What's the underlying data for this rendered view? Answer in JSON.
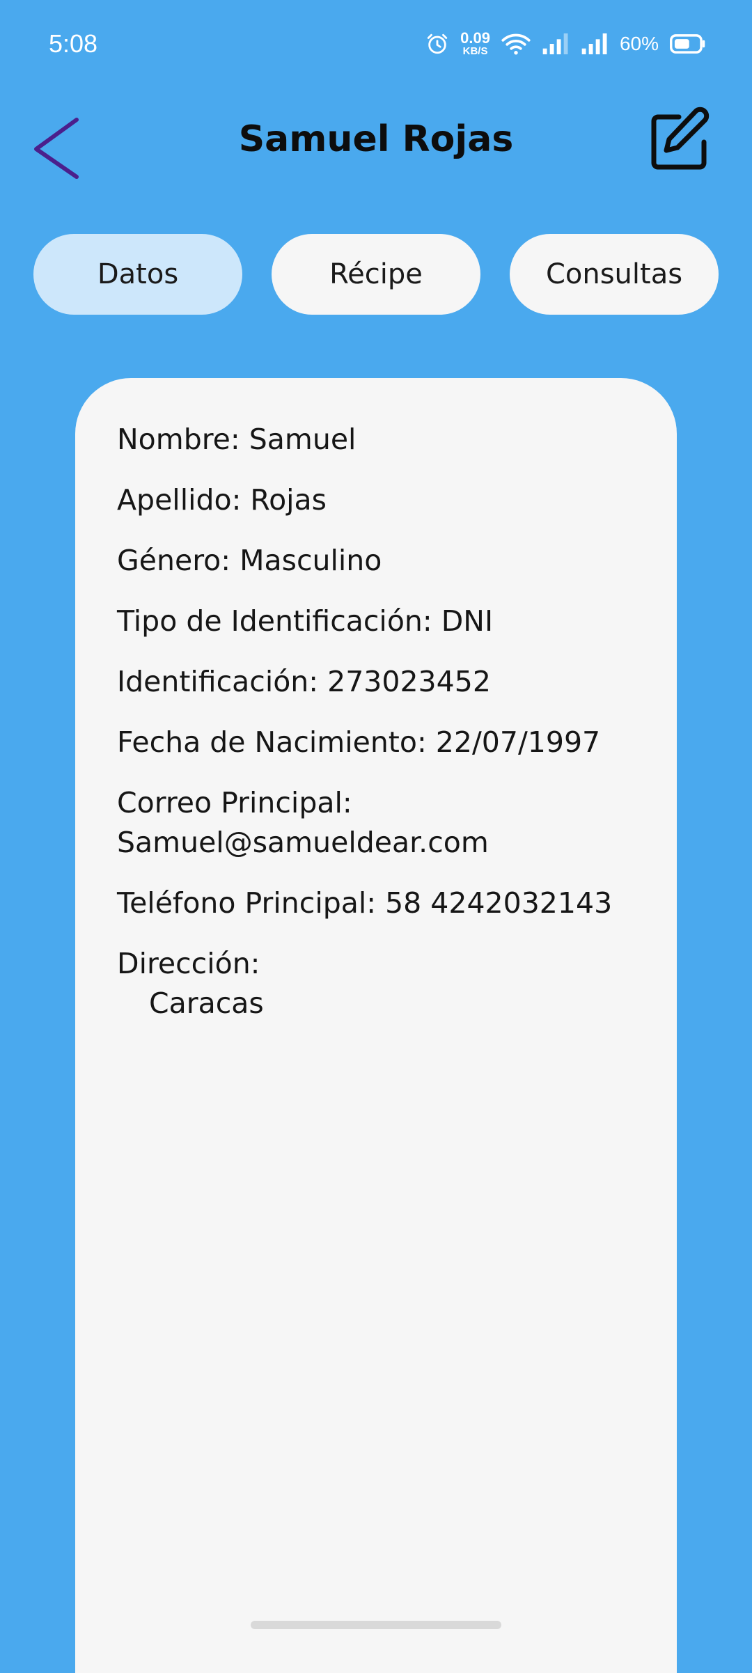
{
  "status_bar": {
    "time": "5:08",
    "net_speed_value": "0.09",
    "net_speed_unit": "KB/S",
    "battery": "60%",
    "icons": [
      "alarm-icon",
      "wifi-icon",
      "signal-icon",
      "signal-icon",
      "battery-icon"
    ]
  },
  "header": {
    "title": "Samuel Rojas",
    "back_icon": "chevron-left-icon",
    "edit_icon": "edit-icon"
  },
  "tabs": [
    {
      "label": "Datos",
      "active": true
    },
    {
      "label": "Récipe",
      "active": false
    },
    {
      "label": "Consultas",
      "active": false
    }
  ],
  "patient": {
    "nombre": "Nombre: Samuel",
    "apellido": "Apellido: Rojas",
    "genero": "Género: Masculino",
    "tipo_identificacion": "Tipo de Identificación: DNI",
    "identificacion": "Identificación: 273023452",
    "fecha_nacimiento": "Fecha de Nacimiento: 22/07/1997",
    "correo_label": "Correo Principal:",
    "correo_value": "Samuel@samueldear.com",
    "telefono": "Teléfono Principal: 58 4242032143",
    "direccion_label": "Dirección:",
    "direccion_value": "Caracas"
  },
  "colors": {
    "background": "#4aa9ee",
    "card": "#f6f6f6",
    "tab_active": "#cde7fb",
    "back_chevron": "#4b1f8c"
  }
}
